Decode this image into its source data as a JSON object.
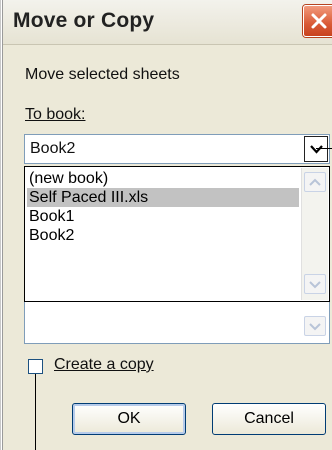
{
  "dialog": {
    "title": "Move or Copy",
    "move_label": "Move selected sheets",
    "to_book_label": "To book:",
    "to_book_value": "Book2",
    "book_options": [
      "(new book)",
      "Self Paced III.xls",
      "Book1",
      "Book2"
    ],
    "highlighted_option": "Self Paced III.xls",
    "create_copy_label": "Create a copy",
    "create_copy_checked": false,
    "ok_label": "OK",
    "cancel_label": "Cancel"
  },
  "icons": {
    "close": "close-icon",
    "dropdown": "chevron-down-icon",
    "scroll_up": "chevron-up-icon",
    "scroll_down": "chevron-down-icon"
  },
  "colors": {
    "dialog_bg": "#ece9d8",
    "close_button": "#d95a36",
    "selection": "#c2c2c2",
    "field_border": "#7f9db9"
  }
}
